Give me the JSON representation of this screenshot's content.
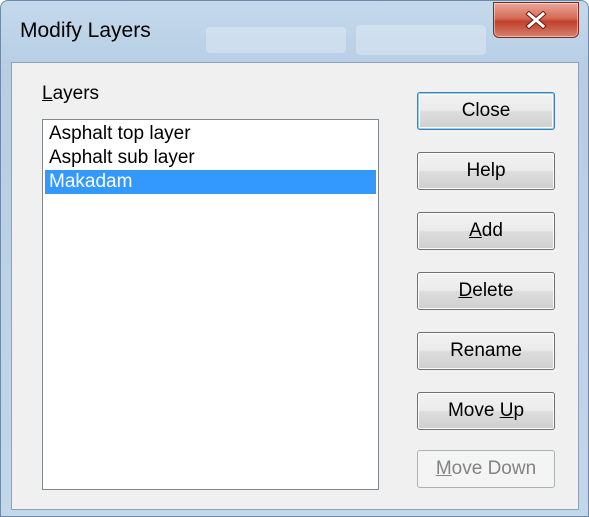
{
  "window": {
    "title": "Modify Layers",
    "close_icon": "close-x-icon"
  },
  "layers": {
    "label_accel": "L",
    "label_rest": "ayers",
    "items": [
      {
        "label": "Asphalt top layer",
        "selected": false
      },
      {
        "label": "Asphalt sub layer",
        "selected": false
      },
      {
        "label": "Makadam",
        "selected": true
      }
    ]
  },
  "buttons": {
    "close": {
      "label": "Close",
      "default": true
    },
    "help": {
      "label": "Help"
    },
    "add": {
      "accel": "A",
      "rest": "dd"
    },
    "delete": {
      "accel": "D",
      "rest": "elete"
    },
    "rename": {
      "label": "Rename"
    },
    "move_up": {
      "pre": "Move ",
      "accel": "U",
      "rest": "p"
    },
    "move_down": {
      "accel": "M",
      "rest": "ove Down",
      "disabled": true
    }
  },
  "colors": {
    "selection": "#3399ff",
    "close_button_red": "#c0402a"
  }
}
